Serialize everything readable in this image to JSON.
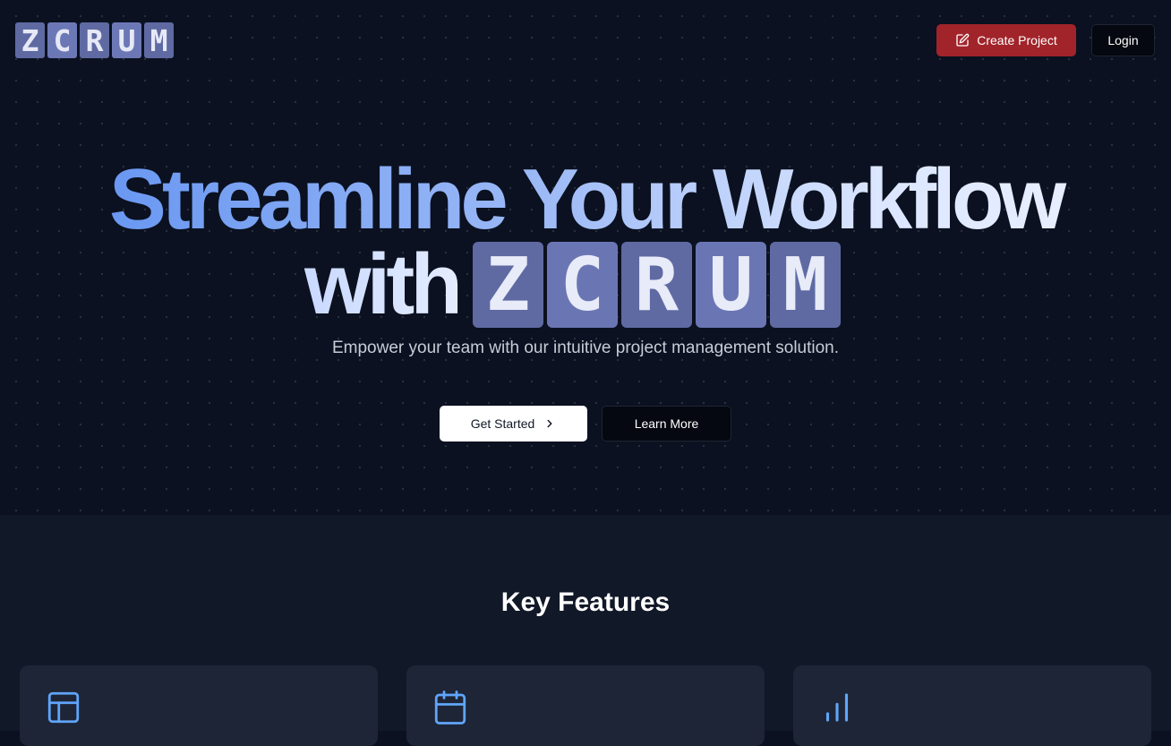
{
  "header": {
    "logo_letters": [
      "Z",
      "C",
      "R",
      "U",
      "M"
    ],
    "create_project_label": "Create Project",
    "login_label": "Login"
  },
  "hero": {
    "headline_line1": "Streamline Your Workflow",
    "headline_with": "with",
    "logo_letters": [
      "Z",
      "C",
      "R",
      "U",
      "M"
    ],
    "subtitle": "Empower your team with our intuitive project management solution.",
    "get_started_label": "Get Started",
    "learn_more_label": "Learn More"
  },
  "features": {
    "title": "Key Features",
    "cards": [
      {
        "icon": "layout-icon"
      },
      {
        "icon": "calendar-icon"
      },
      {
        "icon": "bar-chart-icon"
      }
    ]
  },
  "colors": {
    "background": "#0b1120",
    "features_background": "#111827",
    "card_background": "#1e2536",
    "create_button": "#a1242a",
    "icon_accent": "#60a5fa",
    "logo_tile": "#5f6aa3"
  }
}
